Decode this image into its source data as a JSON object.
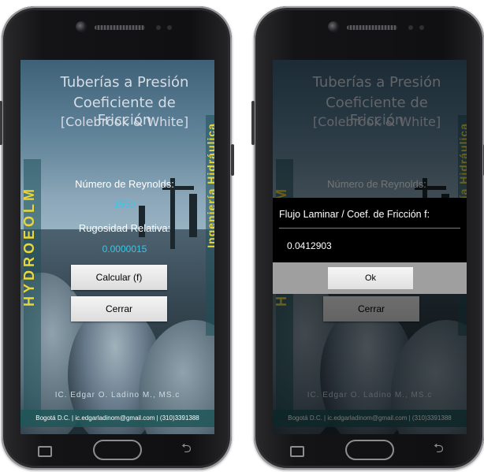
{
  "app": {
    "title_line1": "Tuberías a Presión",
    "title_line2": "Coeficiente de Fricción",
    "title_line3": "[Colebrook & White]",
    "side_left": "HYDROEOLM",
    "side_right": "Ingeniería Hidráulica",
    "reynolds_label": "Número de Reynolds:",
    "reynolds_value": "1550",
    "rugosidad_label": "Rugosidad Relativa:",
    "rugosidad_value": "0.0000015",
    "calc_button": "Calcular (f)",
    "close_button": "Cerrar",
    "author": "IC. Edgar O. Ladino M., MS.c",
    "contact": "Bogotá D.C. | ic.edgarladinom@gmail.com | (310)3391388"
  },
  "dialog": {
    "title": "Flujo Laminar / Coef. de Fricción f:",
    "value": "0.0412903",
    "ok_button": "Ok"
  },
  "colors": {
    "accent_value": "#39c6e6",
    "side_text": "#e8d63a",
    "footer_band": "#1f5658"
  },
  "icons": {
    "nav_recent": "recent-apps-icon",
    "nav_home": "home-icon",
    "nav_back": "back-icon"
  }
}
